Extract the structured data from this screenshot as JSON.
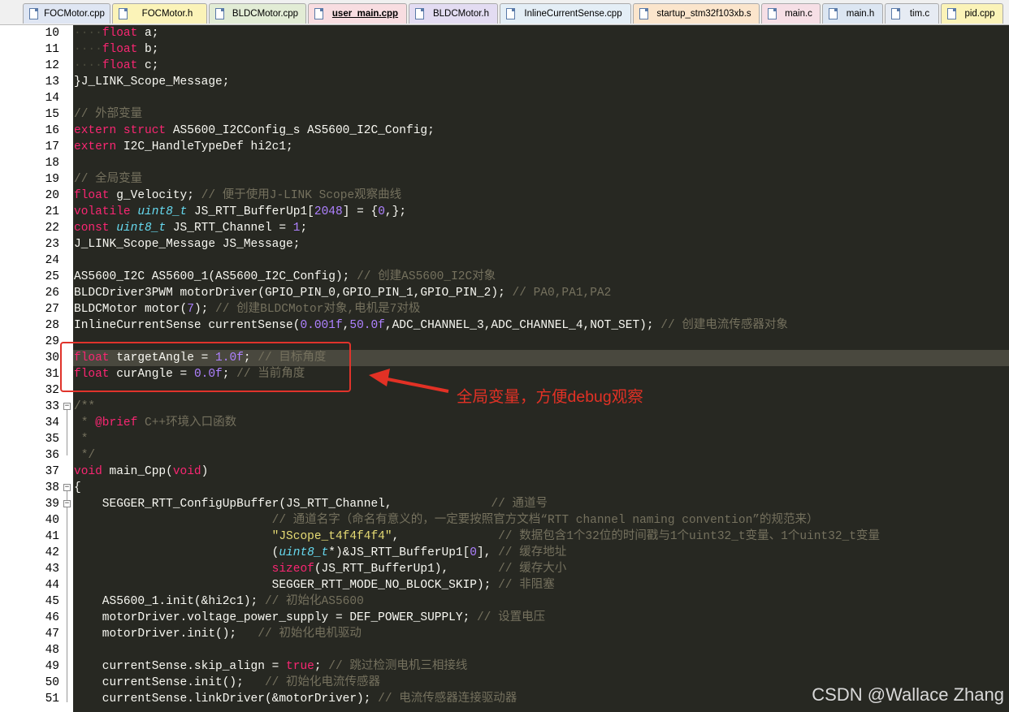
{
  "tabs": [
    {
      "label": "FOCMotor.cpp",
      "color": "#dfe6f3",
      "active": false
    },
    {
      "label": "FOCMotor.h",
      "color": "#fbf3b8",
      "active": false
    },
    {
      "label": "BLDCMotor.cpp",
      "color": "#e2ecd5",
      "active": false
    },
    {
      "label": "user_main.cpp",
      "color": "#f8dde1",
      "active": true
    },
    {
      "label": "BLDCMotor.h",
      "color": "#e3dcf2",
      "active": false
    },
    {
      "label": "InlineCurrentSense.cpp",
      "color": "#e4eef6",
      "active": false
    },
    {
      "label": "startup_stm32f103xb.s",
      "color": "#fbe5cc",
      "active": false
    },
    {
      "label": "main.c",
      "color": "#f6dfe6",
      "active": false
    },
    {
      "label": "main.h",
      "color": "#dce6f2",
      "active": false
    },
    {
      "label": "tim.c",
      "color": "#e6ebf3",
      "active": false
    },
    {
      "label": "pid.cpp",
      "color": "#fbf3b8",
      "active": false
    }
  ],
  "code": {
    "line_numbers": [
      "10",
      "11",
      "12",
      "13",
      "14",
      "15",
      "16",
      "17",
      "18",
      "19",
      "20",
      "21",
      "22",
      "23",
      "24",
      "25",
      "26",
      "27",
      "28",
      "29",
      "30",
      "31",
      "32",
      "33",
      "34",
      "35",
      "36",
      "37",
      "38",
      "39",
      "40",
      "41",
      "42",
      "43",
      "44",
      "45",
      "46",
      "47",
      "48",
      "49",
      "50",
      "51"
    ],
    "lines": [
      "····float a;",
      "····float b;",
      "····float c;",
      "}J_LINK_Scope_Message;",
      "",
      "// 外部变量",
      "extern struct AS5600_I2CConfig_s AS5600_I2C_Config;",
      "extern I2C_HandleTypeDef hi2c1;",
      "",
      "// 全局变量",
      "float g_Velocity; // 便于使用J-LINK Scope观察曲线",
      "volatile uint8_t JS_RTT_BufferUp1[2048] = {0,};",
      "const uint8_t JS_RTT_Channel = 1;",
      "J_LINK_Scope_Message JS_Message;",
      "",
      "AS5600_I2C AS5600_1(AS5600_I2C_Config); // 创建AS5600_I2C对象",
      "BLDCDriver3PWM motorDriver(GPIO_PIN_0,GPIO_PIN_1,GPIO_PIN_2); // PA0,PA1,PA2",
      "BLDCMotor motor(7); // 创建BLDCMotor对象,电机是7对极",
      "InlineCurrentSense currentSense(0.001f,50.0f,ADC_CHANNEL_3,ADC_CHANNEL_4,NOT_SET); // 创建电流传感器对象",
      "",
      "float targetAngle = 1.0f; // 目标角度",
      "float curAngle = 0.0f; // 当前角度",
      "",
      "/**",
      " * @brief C++环境入口函数",
      " *",
      " */",
      "void main_Cpp(void)",
      "{",
      "    SEGGER_RTT_ConfigUpBuffer(JS_RTT_Channel,              // 通道号",
      "                            // 通道名字（命名有意义的，一定要按照官方文档“RTT channel naming convention”的规范来）",
      "                            \"JScope_t4f4f4f4\",              // 数据包含1个32位的时间戳与1个uint32_t变量、1个uint32_t变量",
      "                            (uint8_t*)&JS_RTT_BufferUp1[0], // 缓存地址",
      "                            sizeof(JS_RTT_BufferUp1),       // 缓存大小",
      "                            SEGGER_RTT_MODE_NO_BLOCK_SKIP); // 非阻塞",
      "    AS5600_1.init(&hi2c1); // 初始化AS5600",
      "    motorDriver.voltage_power_supply = DEF_POWER_SUPPLY; // 设置电压",
      "    motorDriver.init();   // 初始化电机驱动",
      "",
      "    currentSense.skip_align = true; // 跳过检测电机三相接线",
      "    currentSense.init();   // 初始化电流传感器",
      "    currentSense.linkDriver(&motorDriver); // 电流传感器连接驱动器"
    ]
  },
  "annotation": {
    "text": "全局变量，方便debug观察",
    "color": "#e23125"
  },
  "watermark": "CSDN @Wallace Zhang",
  "colors": {
    "editor_bg": "#272822",
    "keyword": "#f92672",
    "type": "#66d9ef",
    "number": "#ae81ff",
    "string": "#e6db74",
    "comment": "#75715e",
    "highlight_box": "#e0332b"
  }
}
